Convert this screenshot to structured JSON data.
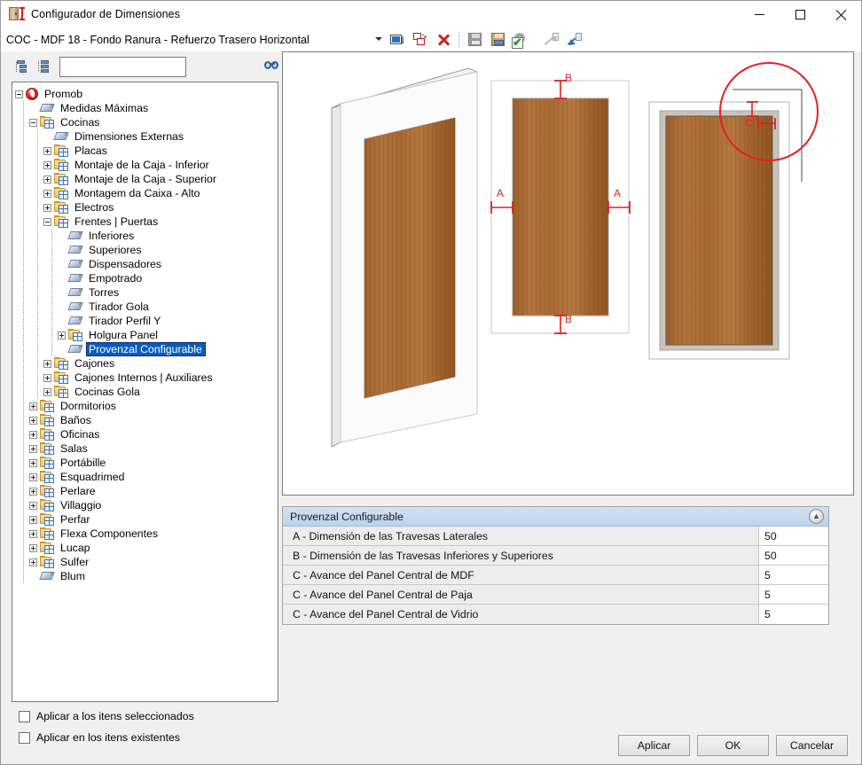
{
  "window": {
    "title": "Configurador de Dimensiones",
    "icon": "cabinet-dimension-icon",
    "minimize_label": "Minimizar",
    "maximize_label": "Maximizar",
    "close_label": "Cerrar"
  },
  "toolbar": {
    "combo_value": "COC - MDF 18 - Fondo Ranura - Refuerzo Trasero Horizontal",
    "buttons": [
      {
        "name": "rename-button",
        "icon": "rename-icon"
      },
      {
        "name": "duplicate-button",
        "icon": "copy-icon"
      },
      {
        "name": "delete-button",
        "icon": "red-x-delete-icon"
      },
      {
        "name": "save-button",
        "icon": "floppy-save-icon"
      },
      {
        "name": "save-as-button",
        "icon": "floppy-save-as-icon"
      },
      {
        "name": "apply-settings-button",
        "icon": "gear-check-icon"
      },
      {
        "name": "export-button",
        "icon": "arrow-out-page-icon"
      },
      {
        "name": "import-button",
        "icon": "arrow-in-page-icon"
      }
    ]
  },
  "tree_toolbar": {
    "collapse_all": "collapse-all-icon",
    "expand_all": "expand-all-icon",
    "find": "binoculars-find-icon"
  },
  "search": {
    "value": "",
    "placeholder": ""
  },
  "tree": {
    "items": [
      {
        "label": "Promob",
        "level": 0,
        "toggle": "minus",
        "icon": "promob-logo-icon",
        "selected": false
      },
      {
        "label": "Medidas Máximas",
        "level": 1,
        "toggle": "none",
        "icon": "tag-icon",
        "selected": false
      },
      {
        "label": "Cocinas",
        "level": 1,
        "toggle": "minus",
        "icon": "folder-grid-icon",
        "selected": false
      },
      {
        "label": "Dimensiones Externas",
        "level": 2,
        "toggle": "none",
        "icon": "tag-icon",
        "selected": false
      },
      {
        "label": "Placas",
        "level": 2,
        "toggle": "plus",
        "icon": "folder-grid-icon",
        "selected": false
      },
      {
        "label": "Montaje de la Caja - Inferior",
        "level": 2,
        "toggle": "plus",
        "icon": "folder-grid-icon",
        "selected": false
      },
      {
        "label": "Montaje de la Caja - Superior",
        "level": 2,
        "toggle": "plus",
        "icon": "folder-grid-icon",
        "selected": false
      },
      {
        "label": "Montagem da Caixa - Alto",
        "level": 2,
        "toggle": "plus",
        "icon": "folder-grid-icon",
        "selected": false
      },
      {
        "label": "Electros",
        "level": 2,
        "toggle": "plus",
        "icon": "folder-grid-icon",
        "selected": false
      },
      {
        "label": "Frentes | Puertas",
        "level": 2,
        "toggle": "minus",
        "icon": "folder-grid-icon",
        "selected": false
      },
      {
        "label": "Inferiores",
        "level": 3,
        "toggle": "none",
        "icon": "tag-icon",
        "selected": false
      },
      {
        "label": "Superiores",
        "level": 3,
        "toggle": "none",
        "icon": "tag-icon",
        "selected": false
      },
      {
        "label": "Dispensadores",
        "level": 3,
        "toggle": "none",
        "icon": "tag-icon",
        "selected": false
      },
      {
        "label": "Empotrado",
        "level": 3,
        "toggle": "none",
        "icon": "tag-icon",
        "selected": false
      },
      {
        "label": "Torres",
        "level": 3,
        "toggle": "none",
        "icon": "tag-icon",
        "selected": false
      },
      {
        "label": "Tirador Gola",
        "level": 3,
        "toggle": "none",
        "icon": "tag-icon",
        "selected": false
      },
      {
        "label": "Tirador Perfil Y",
        "level": 3,
        "toggle": "none",
        "icon": "tag-icon",
        "selected": false
      },
      {
        "label": "Holgura Panel",
        "level": 3,
        "toggle": "plus",
        "icon": "folder-grid-icon",
        "selected": false
      },
      {
        "label": "Provenzal Configurable",
        "level": 3,
        "toggle": "none",
        "icon": "tag-icon",
        "selected": true
      },
      {
        "label": "Cajones",
        "level": 2,
        "toggle": "plus",
        "icon": "folder-grid-icon",
        "selected": false
      },
      {
        "label": "Cajones Internos | Auxiliares",
        "level": 2,
        "toggle": "plus",
        "icon": "folder-grid-icon",
        "selected": false
      },
      {
        "label": "Cocinas Gola",
        "level": 2,
        "toggle": "plus",
        "icon": "folder-grid-icon",
        "selected": false
      },
      {
        "label": "Dormitorios",
        "level": 1,
        "toggle": "plus",
        "icon": "folder-grid-icon",
        "selected": false
      },
      {
        "label": "Baños",
        "level": 1,
        "toggle": "plus",
        "icon": "folder-grid-icon",
        "selected": false
      },
      {
        "label": "Oficinas",
        "level": 1,
        "toggle": "plus",
        "icon": "folder-grid-icon",
        "selected": false
      },
      {
        "label": "Salas",
        "level": 1,
        "toggle": "plus",
        "icon": "folder-grid-icon",
        "selected": false
      },
      {
        "label": "Portábille",
        "level": 1,
        "toggle": "plus",
        "icon": "folder-grid-icon",
        "selected": false
      },
      {
        "label": "Esquadrimed",
        "level": 1,
        "toggle": "plus",
        "icon": "folder-grid-icon",
        "selected": false
      },
      {
        "label": "Perlare",
        "level": 1,
        "toggle": "plus",
        "icon": "folder-grid-icon",
        "selected": false
      },
      {
        "label": "Villaggio",
        "level": 1,
        "toggle": "plus",
        "icon": "folder-grid-icon",
        "selected": false
      },
      {
        "label": "Perfar",
        "level": 1,
        "toggle": "plus",
        "icon": "folder-grid-icon",
        "selected": false
      },
      {
        "label": "Flexa Componentes",
        "level": 1,
        "toggle": "plus",
        "icon": "folder-grid-icon",
        "selected": false
      },
      {
        "label": "Lucap",
        "level": 1,
        "toggle": "plus",
        "icon": "folder-grid-icon",
        "selected": false
      },
      {
        "label": "Sulfer",
        "level": 1,
        "toggle": "plus",
        "icon": "folder-grid-icon",
        "selected": false
      },
      {
        "label": "Blum",
        "level": 1,
        "toggle": "none",
        "icon": "tag-icon",
        "selected": false
      }
    ]
  },
  "viewport": {
    "dimension_labels": {
      "a_left": "A",
      "a_right": "A",
      "b_top": "B",
      "b_bottom": "B",
      "c": "C"
    }
  },
  "properties": {
    "group_title": "Provenzal Configurable",
    "collapse_icon": "chevron-up-double-icon",
    "rows": [
      {
        "label": "A - Dimensión de las Travesas Laterales",
        "value": "50"
      },
      {
        "label": "B - Dimensión de las Travesas Inferiores y Superiores",
        "value": "50"
      },
      {
        "label": "C - Avance del Panel Central de MDF",
        "value": "5"
      },
      {
        "label": "C - Avance del Panel Central de Paja",
        "value": "5"
      },
      {
        "label": "C - Avance del Panel Central de Vidrio",
        "value": "5"
      }
    ]
  },
  "footer": {
    "checkboxes": [
      {
        "label": "Aplicar a los itens seleccionados",
        "checked": false
      },
      {
        "label": "Aplicar en los itens existentes",
        "checked": false
      }
    ],
    "buttons": {
      "apply": "Aplicar",
      "ok": "OK",
      "cancel": "Cancelar"
    }
  },
  "colors": {
    "selection_blue": "#0a5bbf",
    "dimension_red": "#e02020",
    "group_header": "#bcd3ec",
    "wood": "#a96a33"
  }
}
